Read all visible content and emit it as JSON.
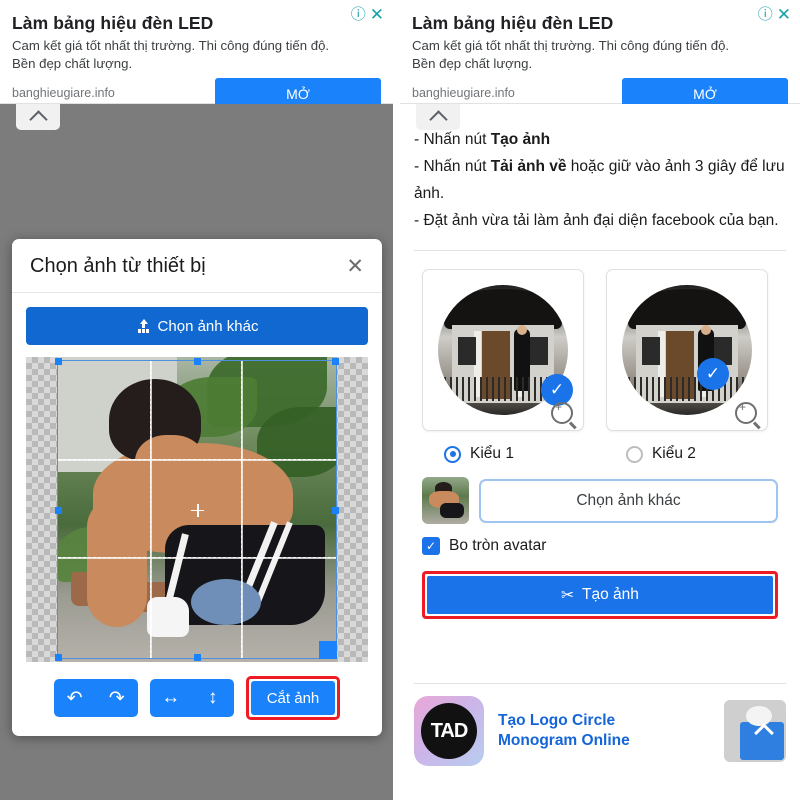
{
  "ad": {
    "title": "Làm bảng hiệu đèn LED",
    "description": "Cam kết giá tốt nhất thị trường. Thi công đúng tiến độ. Bền đẹp chất lượng.",
    "url": "banghieugiare.info",
    "cta_label": "MỞ",
    "info_icon": "info-circle-icon",
    "close_icon": "close-icon",
    "accent_color": "#1a82fb",
    "icon_color": "#1aa0a8"
  },
  "collapse": {
    "icon": "chevron-up-icon"
  },
  "left_panel": {
    "instruction_line": "- Nhấn nút Tạo ảnh",
    "instruction_bold": "Tạo ảnh",
    "modal": {
      "title": "Chọn ảnh từ thiết bị",
      "close_icon": "close-icon",
      "upload_button": "Chọn ảnh khác",
      "upload_icon": "upload-icon",
      "toolbar": {
        "rotate_left_icon": "rotate-counterclockwise-icon",
        "rotate_right_icon": "rotate-clockwise-icon",
        "flip_horizontal_icon": "flip-horizontal-icon",
        "flip_vertical_icon": "flip-vertical-icon",
        "crop_label": "Cắt ảnh",
        "crop_highlight_color": "#ee1b24"
      }
    }
  },
  "right_panel": {
    "instructions": [
      {
        "prefix": "- Nhấn nút ",
        "bold": "Tạo ảnh",
        "suffix": ""
      },
      {
        "prefix": "- Nhấn nút ",
        "bold": "Tải ảnh về",
        "suffix": " hoặc giữ vào ảnh 3 giây để lưu ảnh."
      },
      {
        "prefix": "- Đặt ảnh vừa tải làm ảnh đại diện facebook của bạn.",
        "bold": "",
        "suffix": ""
      }
    ],
    "styles": [
      {
        "label": "Kiểu 1",
        "selected": true,
        "check_icon": "check-icon",
        "zoom_icon": "zoom-in-icon"
      },
      {
        "label": "Kiểu 2",
        "selected": false,
        "check_icon": "check-icon",
        "zoom_icon": "zoom-in-icon"
      }
    ],
    "pick_button": "Chọn ảnh khác",
    "checkbox": {
      "label": "Bo tròn avatar",
      "checked": true,
      "check_icon": "check-icon"
    },
    "make_button": {
      "label": "Tạo ảnh",
      "icon": "scissors-icon",
      "highlight_color": "#ee1b24",
      "color": "#1a73e8"
    }
  },
  "footer_ad": {
    "title_line1": "Tạo Logo Circle",
    "title_line2": "Monogram Online",
    "logo_text": "TAD",
    "link_color": "#1565d8"
  }
}
